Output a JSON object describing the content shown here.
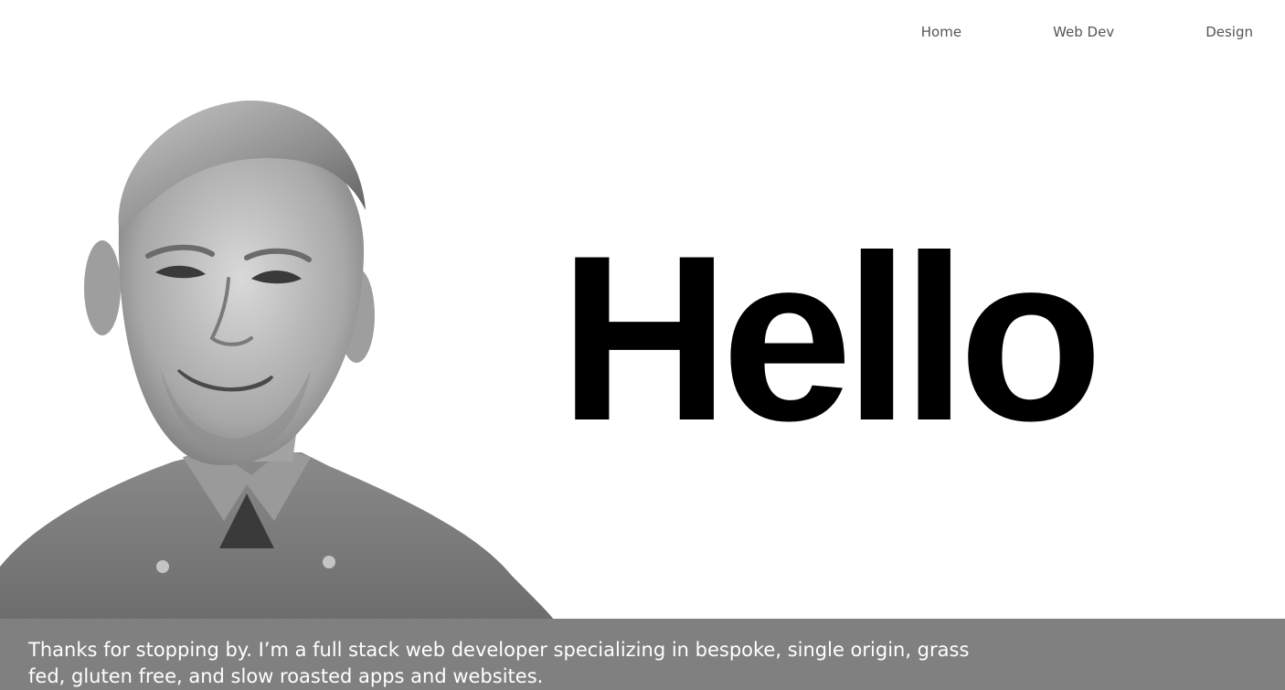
{
  "nav": {
    "items": [
      {
        "label": "Home"
      },
      {
        "label": "Web Dev"
      },
      {
        "label": "Design"
      }
    ]
  },
  "hero": {
    "heading": "Hello",
    "portrait_alt": "Black and white portrait photo of a smiling man"
  },
  "intro": {
    "text": "Thanks for stopping by. I’m a full stack web developer specializing in bespoke, single origin, grass fed, gluten free, and slow roasted apps and websites."
  },
  "colors": {
    "background": "#ffffff",
    "band": "#808080",
    "heading": "#000000",
    "nav_text": "#555555",
    "intro_text": "#ffffff"
  }
}
